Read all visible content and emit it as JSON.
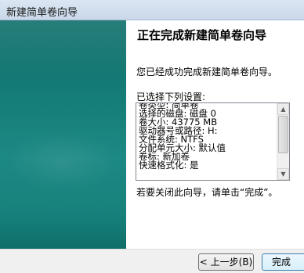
{
  "window": {
    "title": "新建简单卷向导"
  },
  "page": {
    "heading": "正在完成新建简单卷向导",
    "intro": "您已经成功完成新建简单卷向导。",
    "settings_label": "已选择下列设置:",
    "settings_items": [
      "卷类型: 简单卷",
      "选择的磁盘: 磁盘 0",
      "卷大小: 43775 MB",
      "驱动器号或路径: H:",
      "文件系统: NTFS",
      "分配单元大小: 默认值",
      "卷标: 新加卷",
      "快速格式化: 是"
    ],
    "closing": "若要关闭此向导，请单击“完成”。"
  },
  "buttons": {
    "back_label": "< 上一步(B)",
    "finish_label": "完成"
  },
  "colors": {
    "side_panel": "#167d78",
    "titlebar": "#d3e0ee",
    "footer": "#f0f0f0"
  }
}
